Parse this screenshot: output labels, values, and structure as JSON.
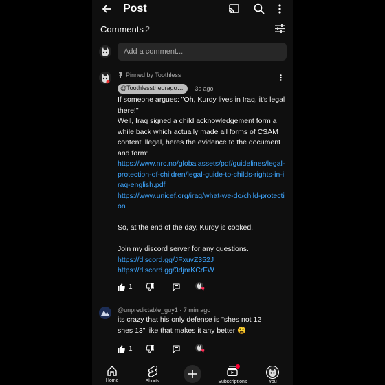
{
  "header": {
    "title": "Post",
    "back_icon": "arrow-left-icon",
    "cast_icon": "cast-icon",
    "search_icon": "search-icon",
    "more_icon": "more-vert-icon"
  },
  "comments_header": {
    "label": "Comments",
    "count": "2",
    "filter_icon": "sort-filter-icon"
  },
  "add_comment": {
    "placeholder": "Add a comment..."
  },
  "pinned_comment": {
    "pinned_label": "Pinned by Toothless",
    "author": "@Toothlessthedragon...",
    "time": "· 3s ago",
    "paragraph1": "If someone argues: \"Oh, Kurdy lives in Iraq, it's legal there!\"",
    "paragraph2": "Well, Iraq signed a child acknowledgement form a while back which actually made all forms of CSAM content illegal, heres the evidence to the document and form:",
    "link1": "https://www.nrc.no/globalassets/pdf/guidelines/legal-protection-of-children/legal-guide-to-childs-rights-in-iraq-english.pdf",
    "link2": "https://www.unicef.org/iraq/what-we-do/child-protection",
    "paragraph3": "So, at the end of the day, Kurdy is cooked.",
    "paragraph4": "Join my discord server for any questions.",
    "link3": "https://discord.gg/JFxuvZ352J",
    "link4": "https://discord.gg/3djnrKCrFW",
    "likes": "1"
  },
  "second_comment": {
    "author": "@unpredictable_guy1",
    "time": "· 7 min ago",
    "text": "its crazy that his only defense is \"shes not 12 shes 13\" like that makes it any better 😩",
    "likes": "1"
  },
  "bottom_nav": {
    "items": [
      {
        "label": "Home",
        "icon": "home-icon"
      },
      {
        "label": "Shorts",
        "icon": "shorts-icon"
      },
      {
        "label": "",
        "icon": "add-icon"
      },
      {
        "label": "Subscriptions",
        "icon": "subscriptions-icon"
      },
      {
        "label": "You",
        "icon": "avatar-icon"
      }
    ]
  }
}
